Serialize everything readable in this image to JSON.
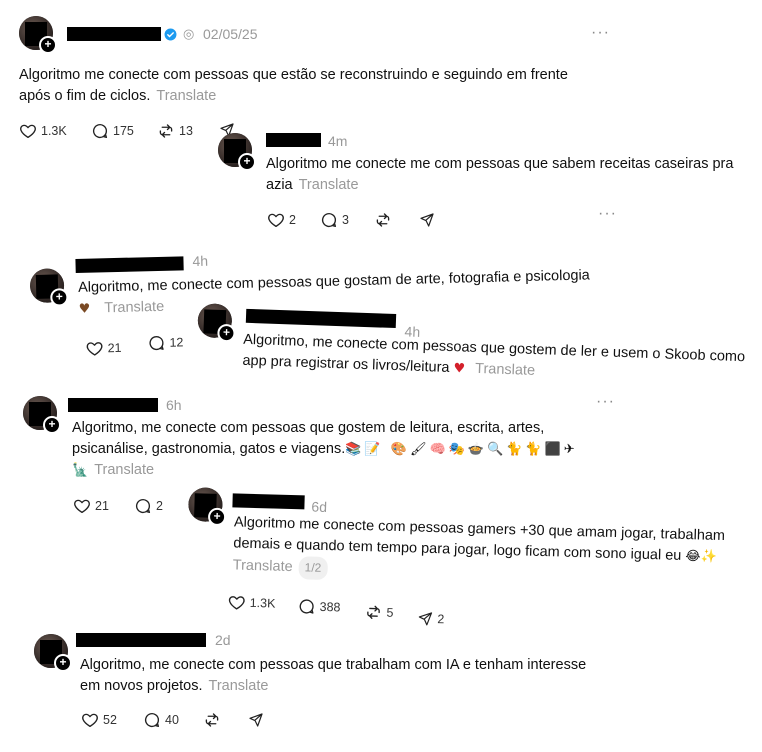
{
  "posts": [
    {
      "time": "02/05/25",
      "text": "Algoritmo me conecte com pessoas que estão se reconstruindo e seguindo em frente",
      "text2": "após o fim de ciclos.",
      "translate": "Translate",
      "likes": "1.3K",
      "replies": "175",
      "reposts": "13"
    },
    {
      "time": "4m",
      "text": "Algoritmo me conecte me com pessoas que sabem receitas caseiras pra",
      "text2": "azia",
      "translate": "Translate",
      "likes": "2",
      "replies": "3"
    },
    {
      "time": "4h",
      "text": "Algoritmo, me conecte com pessoas que gostam de arte, fotografia e psicologia",
      "translate": "Translate",
      "likes": "21",
      "replies": "12"
    },
    {
      "time": "4h",
      "text": "Algoritmo, me conecte com pessoas que gostem de ler e usem o Skoob como",
      "text2": "app pra registrar os livros/leitura",
      "translate": "Translate"
    },
    {
      "time": "6h",
      "text": "Algoritmo, me conecte com pessoas que gostem de leitura, escrita, artes,",
      "text2": "psicanálise, gastronomia, gatos e viagens.",
      "translate": "Translate",
      "likes": "21",
      "replies": "2"
    },
    {
      "time": "6d",
      "text": "Algoritmo me conecte com pessoas gamers +30 que amam jogar, trabalham",
      "text2": "demais e quando tem tempo para jogar, logo ficam com sono igual eu",
      "translate": "Translate",
      "page": "1/2",
      "likes": "1.3K",
      "replies": "388",
      "reposts": "5",
      "shares": "2"
    },
    {
      "time": "2d",
      "text": "Algoritmo, me conecte com pessoas que trabalham com IA e tenham interesse",
      "text2": "em novos projetos.",
      "translate": "Translate",
      "likes": "52",
      "replies": "40"
    }
  ],
  "icons": {
    "more": "more-icon",
    "like": "heart-icon",
    "reply": "comment-icon",
    "repost": "repost-icon",
    "share": "send-icon"
  },
  "colors": {
    "verified": "#1d9bf0",
    "muted": "#999999",
    "text": "#101010"
  }
}
